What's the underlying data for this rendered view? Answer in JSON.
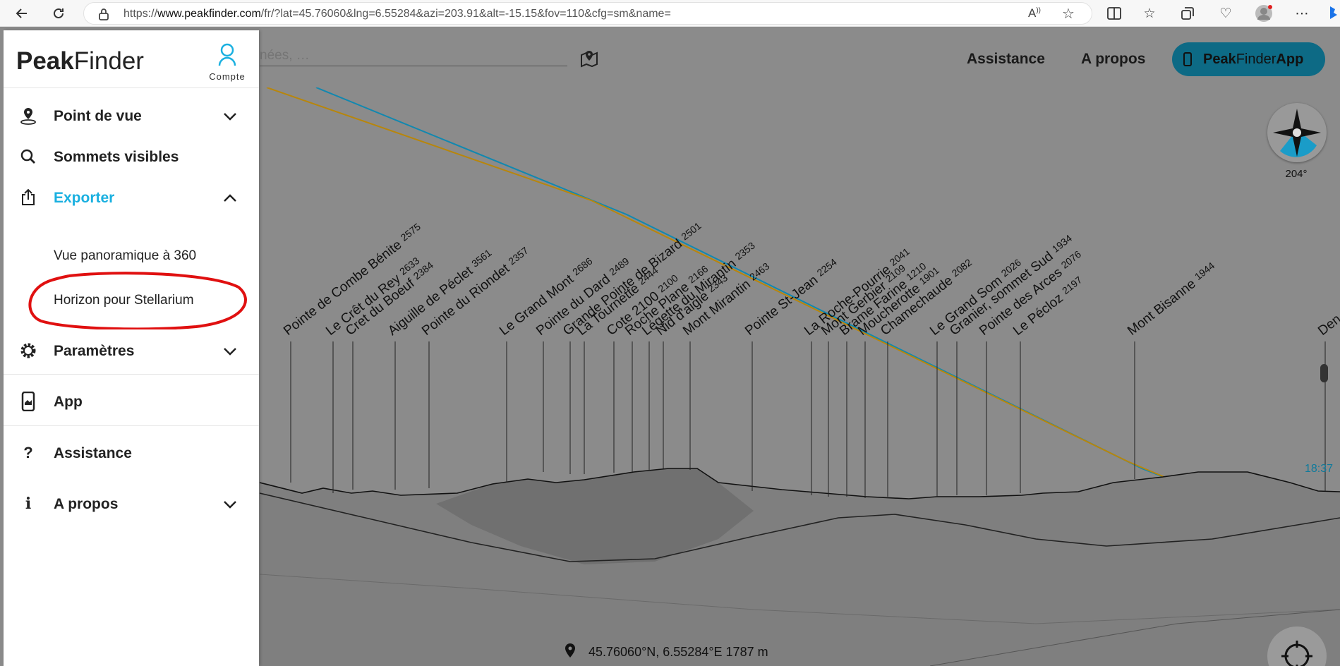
{
  "browser": {
    "url_prefix": "https://",
    "url_host": "www.peakfinder.com",
    "url_rest": "/fr/?lat=45.76060&lng=6.55284&azi=203.91&alt=-15.15&fov=110&cfg=sm&name="
  },
  "sidebar": {
    "brand_bold": "Peak",
    "brand_light": "Finder",
    "account_label": "Compte",
    "items": {
      "point_de_vue": "Point de vue",
      "sommets_visibles": "Sommets visibles",
      "exporter": "Exporter",
      "vue_panoramique": "Vue panoramique à 360",
      "horizon_stellarium": "Horizon pour Stellarium",
      "parametres": "Paramètres",
      "app": "App",
      "assistance": "Assistance",
      "a_propos": "A propos"
    },
    "accent_color": "#1ab0e0"
  },
  "header": {
    "search_placeholder": "nées, …",
    "assistance": "Assistance",
    "a_propos": "A propos",
    "app_button_bold": "Peak",
    "app_button_light": "Finder",
    "app_button_suffix": " App"
  },
  "compass": {
    "azimuth": "204°"
  },
  "coordinates": "45.76060°N, 6.55284°E 1787 m",
  "sun_label": "18:37",
  "peaks": [
    {
      "name": "Pointe de Combe Bénite",
      "alt": "2575"
    },
    {
      "name": "Le Crêt du Rey",
      "alt": "2633"
    },
    {
      "name": "Cret du Boeuf",
      "alt": "2384"
    },
    {
      "name": "Aiguille de Péclet",
      "alt": "3561"
    },
    {
      "name": "Pointe du Riondet",
      "alt": "2357"
    },
    {
      "name": "Le Grand Mont",
      "alt": "2686"
    },
    {
      "name": "Pointe du Dard",
      "alt": "2489"
    },
    {
      "name": "Grande Pointe de Bizard",
      "alt": "2501"
    },
    {
      "name": "La Tournette",
      "alt": "2444"
    },
    {
      "name": "Cote 2100",
      "alt": "2100"
    },
    {
      "name": "Roche Plane",
      "alt": "2166"
    },
    {
      "name": "Légette du Mirantin",
      "alt": "2353"
    },
    {
      "name": "Nid d'aigle",
      "alt": "2343"
    },
    {
      "name": "Mont Mirantin",
      "alt": "2463"
    },
    {
      "name": "Pointe St-Jean",
      "alt": "2254"
    },
    {
      "name": "La Roche-Pourrie",
      "alt": "2041"
    },
    {
      "name": "Mont Gerbier",
      "alt": "2109"
    },
    {
      "name": "Brame Farine",
      "alt": "1210"
    },
    {
      "name": "Moucherotte",
      "alt": "1901"
    },
    {
      "name": "Chamechaude",
      "alt": "2082"
    },
    {
      "name": "Le Grand Som",
      "alt": "2026"
    },
    {
      "name": "Granier, sommet Sud",
      "alt": "1934"
    },
    {
      "name": "Pointe des Arces",
      "alt": "2076"
    },
    {
      "name": "Le Pécloz",
      "alt": "2197"
    },
    {
      "name": "Mont Bisanne",
      "alt": "1944"
    },
    {
      "name": "Den",
      "alt": ""
    }
  ]
}
